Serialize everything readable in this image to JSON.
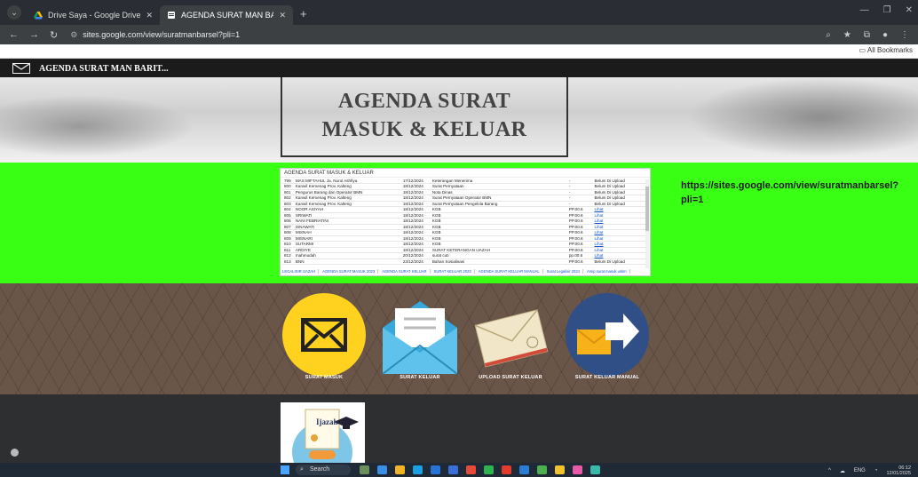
{
  "browser": {
    "tabs": [
      {
        "title": "Drive Saya - Google Drive",
        "icon": "google-drive-icon",
        "active": false
      },
      {
        "title": "AGENDA SURAT MAN BARITO",
        "icon": "google-sites-icon",
        "active": true
      }
    ],
    "url": "sites.google.com/view/suratmanbarsel?pli=1",
    "bookmarks_label": "All Bookmarks"
  },
  "site": {
    "header_title": "AGENDA SURAT MAN BARIT...",
    "hero_line1": "AGENDA SURAT",
    "hero_line2": "MASUK & KELUAR",
    "side_url": "https://sites.google.com/view/suratmanbarsel?pli=1"
  },
  "sheet": {
    "title": "AGENDA SURAT MASUK & KELUAR",
    "rows": [
      [
        "799",
        "MAS MIFTAHUL Ja. Nurul Ashfiya",
        "17/12/2024",
        "Keterangan Menerima",
        "-",
        "Belum Di Upload"
      ],
      [
        "800",
        "Kanwil Kemenag Prov. Kalteng",
        "18/12/2024",
        "Surat Pernyataan",
        "-",
        "Belum Di Upload"
      ],
      [
        "801",
        "Pengurus Barang dan Operator BMN",
        "18/12/2024",
        "Nota Dinas",
        "-",
        "Belum Di Upload"
      ],
      [
        "802",
        "Kanwil Kemenag Prov. Kalteng",
        "18/12/2024",
        "Surat Pernyataan Operator BMN",
        "-",
        "Belum Di Upload"
      ],
      [
        "803",
        "Kanwil Kemenag Prov. Kalteng",
        "18/12/2024",
        "Surat Pernyataan Pengelola Barang",
        "-",
        "Belum Di Upload"
      ],
      [
        "804",
        "NOOR ASIYAH",
        "18/12/2024",
        "KGB",
        "PP.00.6",
        "Lihat"
      ],
      [
        "805",
        "SRIWATI",
        "18/12/2024",
        "KGB",
        "PP.00.6",
        "Lihat"
      ],
      [
        "806",
        "NANI FEBRIATINI",
        "18/12/2024",
        "KGB",
        "PP.00.6",
        "Lihat"
      ],
      [
        "807",
        "ISNAWATI",
        "18/12/2024",
        "KGB",
        "PP.00.6",
        "Lihat"
      ],
      [
        "808",
        "MISNAH",
        "18/12/2024",
        "KGB",
        "PP.00.6",
        "Lihat"
      ],
      [
        "809",
        "MISNARI",
        "18/12/2024",
        "KGB",
        "PP.00.6",
        "Lihat"
      ],
      [
        "810",
        "SUTARMI",
        "18/12/2024",
        "KGB",
        "PP.00.6",
        "Lihat"
      ],
      [
        "811",
        "ARDIYE",
        "18/12/2024",
        "SURAT KETERANGAN IJAZAH",
        "PP.00.6",
        "Lihat"
      ],
      [
        "812",
        "mahmudah",
        "20/12/2024",
        "surat cuti",
        "pp.00.6",
        "Lihat"
      ],
      [
        "813",
        "BNN",
        "23/12/2024",
        "Bahan Sosialisasi",
        "PP.00.6",
        "Belum Di Upload"
      ]
    ],
    "tabs": [
      "LEGALISIR IJAZAH",
      "AGENDA SURAT MASUK 2023",
      "AGENDA SURAT KELUAR",
      "SURAT KELUAR 2023",
      "AGENDA SURAT KELUAR MANUAL",
      "Surat Legalisir 2024",
      "Arsip surat masuk uskm"
    ]
  },
  "icons": [
    {
      "label": "SURAT MASUK",
      "icon": "mail-envelope-icon"
    },
    {
      "label": "SURAT KELUAR",
      "icon": "open-letter-icon"
    },
    {
      "label": "UPLOAD SURAT KELUAR",
      "icon": "parcel-envelope-icon"
    },
    {
      "label": "SURAT KELUAR MANUAL",
      "icon": "send-mail-icon"
    }
  ],
  "ijazah": {
    "text": "Ijazah"
  },
  "taskbar": {
    "search_placeholder": "Search",
    "language": "ENG",
    "time": "06:12",
    "date": "12/01/2025"
  },
  "colors": {
    "green_band": "#38ff14",
    "chevron_band": "#6a5549",
    "dark_band": "#2d2f31",
    "mail_yellow": "#ffd21f",
    "link_blue": "#1155cc"
  }
}
